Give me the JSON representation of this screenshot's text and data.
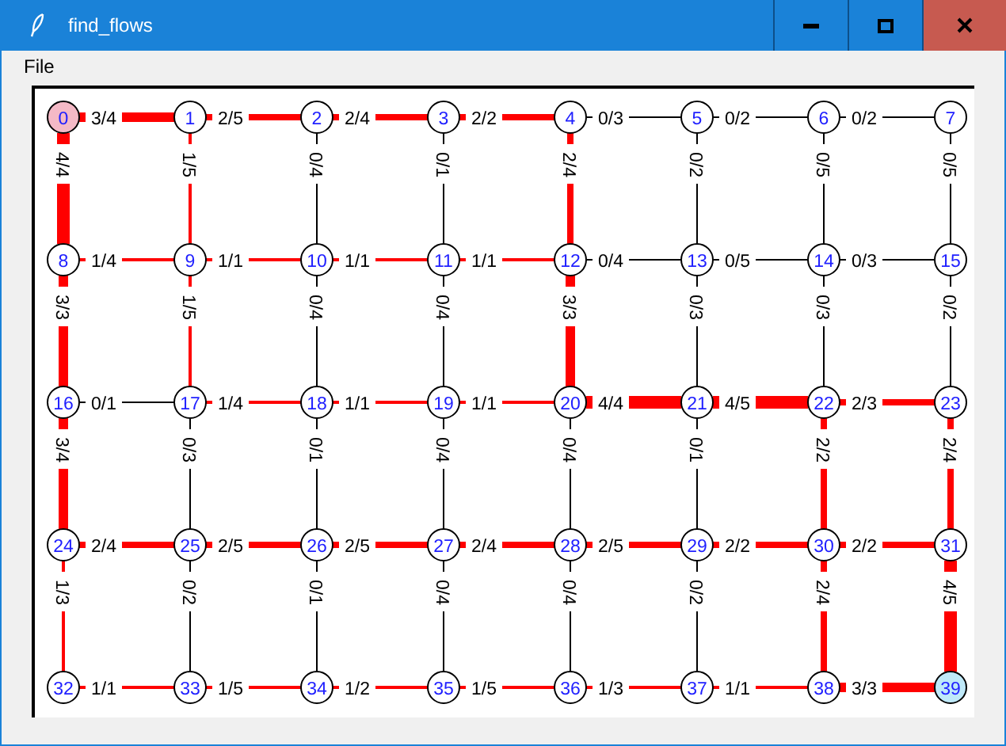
{
  "window": {
    "title": "find_flows"
  },
  "menu": [
    {
      "label": "File"
    }
  ],
  "graph": {
    "node_rows": [
      [
        {
          "label": "0",
          "color": "#f4b9c6"
        },
        {
          "label": "1"
        },
        {
          "label": "2"
        },
        {
          "label": "3"
        },
        {
          "label": "4"
        },
        {
          "label": "5"
        },
        {
          "label": "6"
        },
        {
          "label": "7"
        }
      ],
      [
        {
          "label": "8"
        },
        {
          "label": "9"
        },
        {
          "label": "10"
        },
        {
          "label": "11"
        },
        {
          "label": "12"
        },
        {
          "label": "13"
        },
        {
          "label": "14"
        },
        {
          "label": "15"
        }
      ],
      [
        {
          "label": "16"
        },
        {
          "label": "17"
        },
        {
          "label": "18"
        },
        {
          "label": "19"
        },
        {
          "label": "20"
        },
        {
          "label": "21"
        },
        {
          "label": "22"
        },
        {
          "label": "23"
        }
      ],
      [
        {
          "label": "24"
        },
        {
          "label": "25"
        },
        {
          "label": "26"
        },
        {
          "label": "27"
        },
        {
          "label": "28"
        },
        {
          "label": "29"
        },
        {
          "label": "30"
        },
        {
          "label": "31"
        }
      ],
      [
        {
          "label": "32"
        },
        {
          "label": "33"
        },
        {
          "label": "34"
        },
        {
          "label": "35"
        },
        {
          "label": "36"
        },
        {
          "label": "37"
        },
        {
          "label": "38"
        },
        {
          "label": "39",
          "color": "#bfe9f9"
        }
      ]
    ],
    "horizontal_edges": [
      [
        {
          "label": "3/4",
          "kind": "three"
        },
        {
          "label": "2/5",
          "kind": "two"
        },
        {
          "label": "2/4",
          "kind": "two"
        },
        {
          "label": "2/2",
          "kind": "two"
        },
        {
          "label": "0/3",
          "kind": "zero"
        },
        {
          "label": "0/2",
          "kind": "zero"
        },
        {
          "label": "0/2",
          "kind": "zero"
        }
      ],
      [
        {
          "label": "1/4",
          "kind": "one"
        },
        {
          "label": "1/1",
          "kind": "one"
        },
        {
          "label": "1/1",
          "kind": "one"
        },
        {
          "label": "1/1",
          "kind": "one"
        },
        {
          "label": "0/4",
          "kind": "zero"
        },
        {
          "label": "0/5",
          "kind": "zero"
        },
        {
          "label": "0/3",
          "kind": "zero"
        }
      ],
      [
        {
          "label": "0/1",
          "kind": "zero"
        },
        {
          "label": "1/4",
          "kind": "one"
        },
        {
          "label": "1/1",
          "kind": "one"
        },
        {
          "label": "1/1",
          "kind": "one"
        },
        {
          "label": "4/4",
          "kind": "four"
        },
        {
          "label": "4/5",
          "kind": "four"
        },
        {
          "label": "2/3",
          "kind": "two"
        }
      ],
      [
        {
          "label": "2/4",
          "kind": "two"
        },
        {
          "label": "2/5",
          "kind": "two"
        },
        {
          "label": "2/5",
          "kind": "two"
        },
        {
          "label": "2/4",
          "kind": "two"
        },
        {
          "label": "2/5",
          "kind": "two"
        },
        {
          "label": "2/2",
          "kind": "two"
        },
        {
          "label": "2/2",
          "kind": "two"
        }
      ],
      [
        {
          "label": "1/1",
          "kind": "one"
        },
        {
          "label": "1/5",
          "kind": "one"
        },
        {
          "label": "1/2",
          "kind": "one"
        },
        {
          "label": "1/5",
          "kind": "one"
        },
        {
          "label": "1/3",
          "kind": "one"
        },
        {
          "label": "1/1",
          "kind": "one"
        },
        {
          "label": "3/3",
          "kind": "three"
        }
      ]
    ],
    "vertical_edges": [
      [
        {
          "label": "4/4",
          "kind": "four"
        },
        {
          "label": "1/5",
          "kind": "one"
        },
        {
          "label": "0/4",
          "kind": "zero"
        },
        {
          "label": "0/1",
          "kind": "zero"
        },
        {
          "label": "2/4",
          "kind": "two"
        },
        {
          "label": "0/2",
          "kind": "zero"
        },
        {
          "label": "0/5",
          "kind": "zero"
        },
        {
          "label": "0/5",
          "kind": "zero"
        }
      ],
      [
        {
          "label": "3/3",
          "kind": "three"
        },
        {
          "label": "1/5",
          "kind": "one"
        },
        {
          "label": "0/4",
          "kind": "zero"
        },
        {
          "label": "0/4",
          "kind": "zero"
        },
        {
          "label": "3/3",
          "kind": "three"
        },
        {
          "label": "0/3",
          "kind": "zero"
        },
        {
          "label": "0/3",
          "kind": "zero"
        },
        {
          "label": "0/2",
          "kind": "zero"
        }
      ],
      [
        {
          "label": "3/4",
          "kind": "three"
        },
        {
          "label": "0/3",
          "kind": "zero"
        },
        {
          "label": "0/1",
          "kind": "zero"
        },
        {
          "label": "0/4",
          "kind": "zero"
        },
        {
          "label": "0/4",
          "kind": "zero"
        },
        {
          "label": "0/1",
          "kind": "zero"
        },
        {
          "label": "2/2",
          "kind": "two"
        },
        {
          "label": "2/4",
          "kind": "two"
        }
      ],
      [
        {
          "label": "1/3",
          "kind": "one"
        },
        {
          "label": "0/2",
          "kind": "zero"
        },
        {
          "label": "0/1",
          "kind": "zero"
        },
        {
          "label": "0/4",
          "kind": "zero"
        },
        {
          "label": "0/4",
          "kind": "zero"
        },
        {
          "label": "0/2",
          "kind": "zero"
        },
        {
          "label": "2/4",
          "kind": "two"
        },
        {
          "label": "4/5",
          "kind": "four"
        }
      ]
    ]
  }
}
